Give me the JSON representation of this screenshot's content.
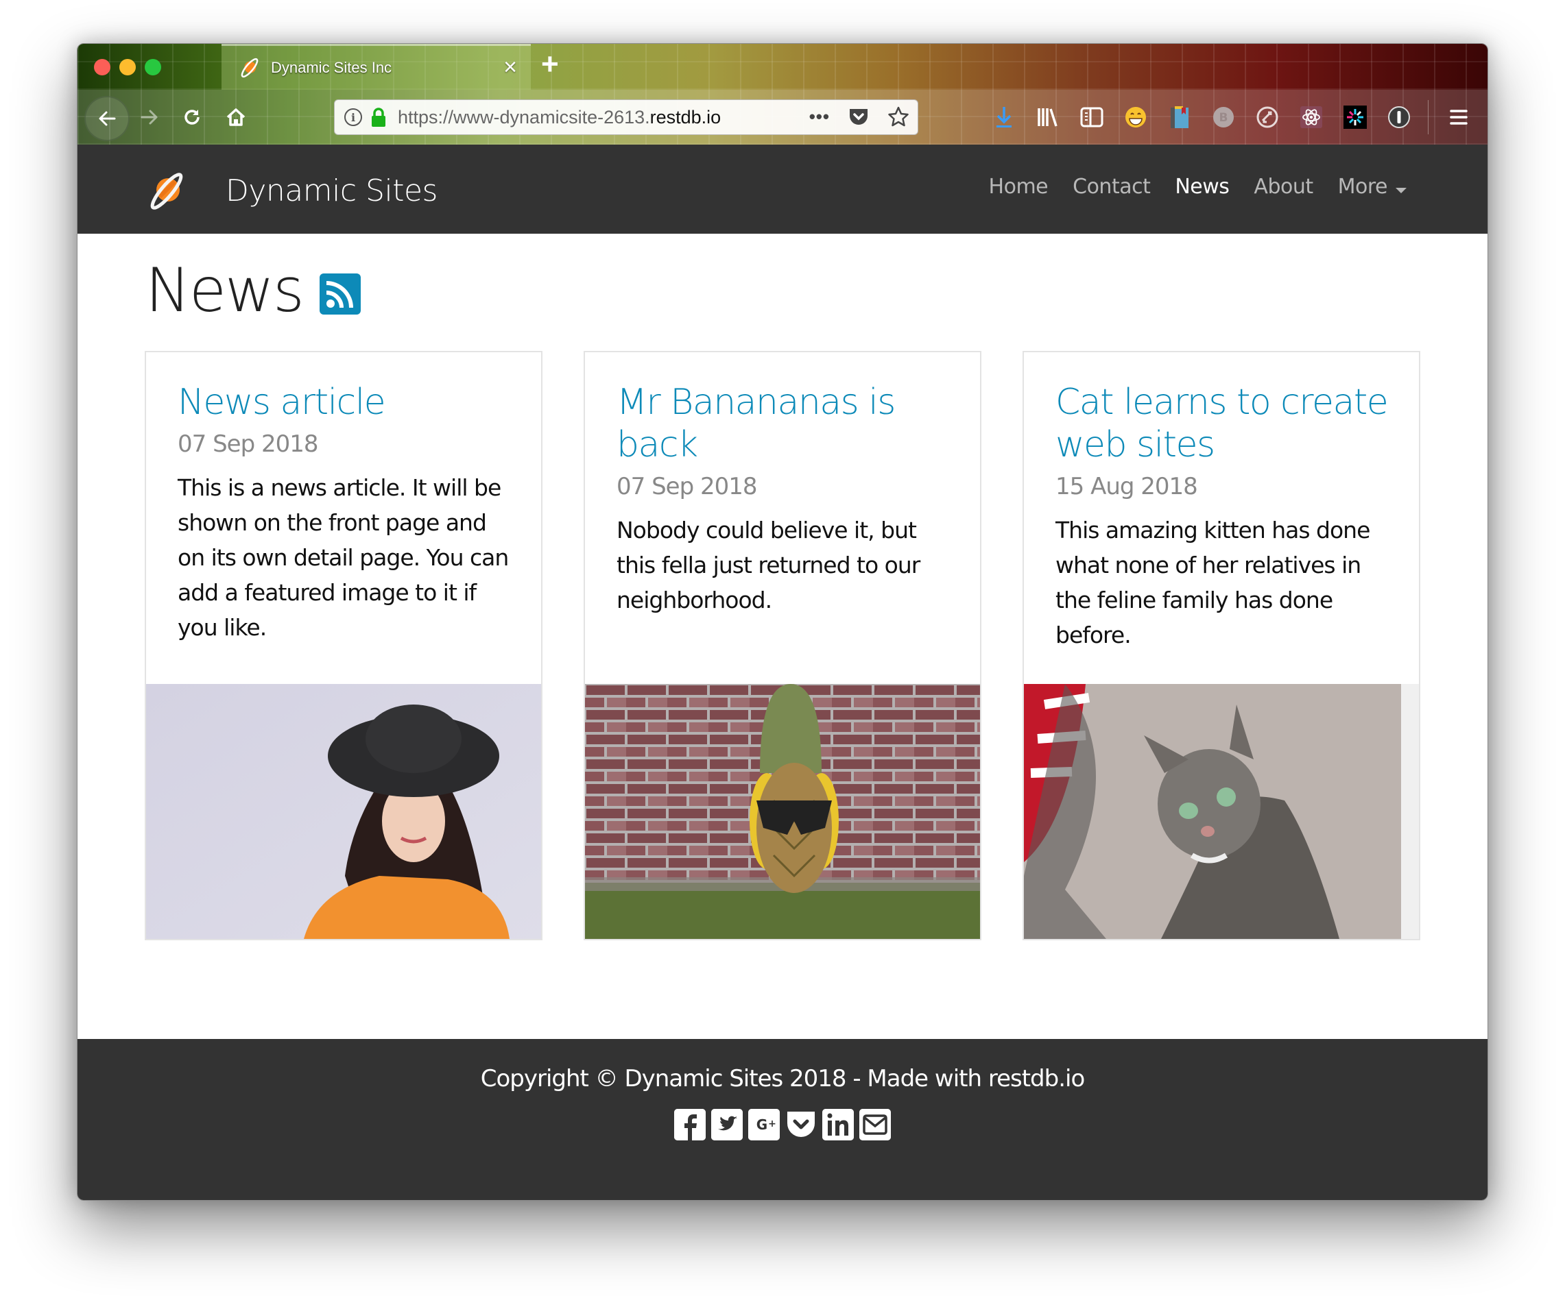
{
  "browser": {
    "tab_title": "Dynamic Sites Inc",
    "url_prefix": "https://www-dynamicsite-2613.",
    "url_domain": "restdb.io",
    "url_suffix": "",
    "toolbar_icons": [
      "download-icon",
      "library-icon",
      "sidebar-icon",
      "emoji-extension-icon",
      "bookmark-extension-icon",
      "b-extension-icon",
      "sync-extension-icon",
      "react-devtools-icon",
      "colorful-extension-icon",
      "onepassword-icon"
    ]
  },
  "site": {
    "brand": "Dynamic Sites",
    "nav": [
      {
        "label": "Home",
        "active": false
      },
      {
        "label": "Contact",
        "active": false
      },
      {
        "label": "News",
        "active": true
      },
      {
        "label": "About",
        "active": false
      },
      {
        "label": "More",
        "active": false,
        "dropdown": true
      }
    ],
    "accent_color": "#0d8ab8",
    "navbar_color": "#333333"
  },
  "page": {
    "title": "News",
    "title_icon": "rss-icon"
  },
  "articles": [
    {
      "title": "News article",
      "date": "07 Sep 2018",
      "excerpt": "This is a news article. It will be shown on the front page and on its own detail page. You can add a featured image to it if you like.",
      "image": "woman-in-black-hat-photo"
    },
    {
      "title": "Mr Banananas is back",
      "date": "07 Sep 2018",
      "excerpt": "Nobody could believe it, but this fella just returned to our neighborhood.",
      "image": "pineapple-with-sunglasses-photo"
    },
    {
      "title": "Cat learns to create web sites",
      "date": "15 Aug 2018",
      "excerpt": "This amazing kitten has done what none of her relatives in the feline family has done before.",
      "image": "tabby-cat-photo"
    }
  ],
  "footer": {
    "copyright": "Copyright © Dynamic Sites 2018 - Made with restdb.io",
    "social": [
      "facebook",
      "twitter",
      "google-plus",
      "pocket",
      "linkedin",
      "email"
    ]
  }
}
